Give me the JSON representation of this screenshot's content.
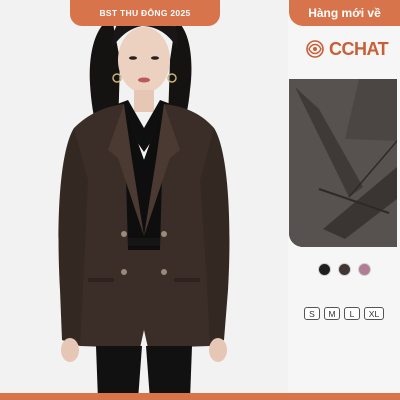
{
  "header": {
    "collection_label": "BST THU ĐÔNG 2025",
    "new_label": "Hàng mới về"
  },
  "brand": {
    "name": "CCHAT",
    "logo_icon": "knot-logo-icon",
    "color": "#c85f37"
  },
  "accent_color": "#d8744c",
  "photo": {
    "subject": "model-in-brown-double-breasted-blazer-icon"
  },
  "detail": {
    "subject": "lapel-fabric-closeup-icon"
  },
  "colors": [
    {
      "name": "black",
      "hex": "#1e1e1e"
    },
    {
      "name": "dark-brown",
      "hex": "#3f3634"
    },
    {
      "name": "mauve",
      "hex": "#b07c96"
    }
  ],
  "sizes": [
    "S",
    "M",
    "L",
    "XL"
  ]
}
